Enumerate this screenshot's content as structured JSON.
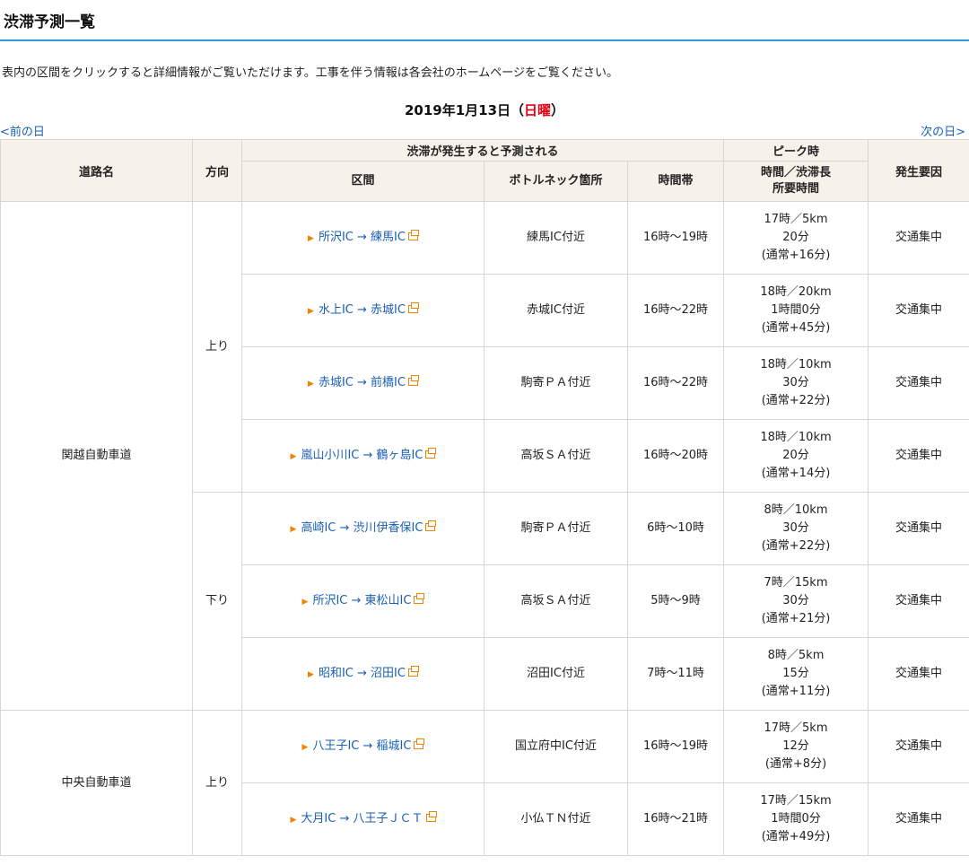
{
  "page": {
    "title": "渋滞予測一覧",
    "intro": "表内の区間をクリックすると詳細情報がご覧いただけます。工事を伴う情報は各会社のホームページをご覧ください。",
    "date": {
      "main": "2019年1月13日（",
      "dow": "日曜",
      "close": "）"
    },
    "prev_day": "<前の日",
    "next_day": "次の日>"
  },
  "table": {
    "headers": {
      "road": "道路名",
      "direction": "方向",
      "predicted_group": "渋滞が発生すると予測される",
      "section": "区間",
      "bottleneck": "ボトルネック箇所",
      "time_band": "時間帯",
      "peak_group": "ピーク時",
      "peak_sub_line1": "時間／渋滞長",
      "peak_sub_line2": "所要時間",
      "cause": "発生要因"
    },
    "roads": [
      {
        "name": "関越自動車道",
        "directions": [
          {
            "label": "上り",
            "rows": [
              {
                "section": "所沢IC → 練馬IC",
                "bottleneck": "練馬IC付近",
                "time": "16時〜19時",
                "peak": "17時／5km",
                "duration": "20分",
                "normal": "(通常+16分)",
                "cause": "交通集中"
              },
              {
                "section": "水上IC → 赤城IC",
                "bottleneck": "赤城IC付近",
                "time": "16時〜22時",
                "peak": "18時／20km",
                "duration": "1時間0分",
                "normal": "(通常+45分)",
                "cause": "交通集中"
              },
              {
                "section": "赤城IC → 前橋IC",
                "bottleneck": "駒寄ＰＡ付近",
                "time": "16時〜22時",
                "peak": "18時／10km",
                "duration": "30分",
                "normal": "(通常+22分)",
                "cause": "交通集中"
              },
              {
                "section": "嵐山小川IC → 鶴ヶ島IC",
                "bottleneck": "高坂ＳＡ付近",
                "time": "16時〜20時",
                "peak": "18時／10km",
                "duration": "20分",
                "normal": "(通常+14分)",
                "cause": "交通集中"
              }
            ]
          },
          {
            "label": "下り",
            "rows": [
              {
                "section": "高崎IC → 渋川伊香保IC",
                "bottleneck": "駒寄ＰＡ付近",
                "time": "6時〜10時",
                "peak": "8時／10km",
                "duration": "30分",
                "normal": "(通常+22分)",
                "cause": "交通集中"
              },
              {
                "section": "所沢IC → 東松山IC",
                "bottleneck": "高坂ＳＡ付近",
                "time": "5時〜9時",
                "peak": "7時／15km",
                "duration": "30分",
                "normal": "(通常+21分)",
                "cause": "交通集中"
              },
              {
                "section": "昭和IC → 沼田IC",
                "bottleneck": "沼田IC付近",
                "time": "7時〜11時",
                "peak": "8時／5km",
                "duration": "15分",
                "normal": "(通常+11分)",
                "cause": "交通集中"
              }
            ]
          }
        ]
      },
      {
        "name": "中央自動車道",
        "directions": [
          {
            "label": "上り",
            "rows": [
              {
                "section": "八王子IC → 稲城IC",
                "bottleneck": "国立府中IC付近",
                "time": "16時〜19時",
                "peak": "17時／5km",
                "duration": "12分",
                "normal": "(通常+8分)",
                "cause": "交通集中"
              },
              {
                "section": "大月IC → 八王子ＪＣＴ",
                "bottleneck": "小仏ＴＮ付近",
                "time": "16時〜21時",
                "peak": "17時／15km",
                "duration": "1時間0分",
                "normal": "(通常+49分)",
                "cause": "交通集中"
              }
            ]
          }
        ]
      }
    ]
  },
  "colors": {
    "title_rule": "#2e9bd6",
    "link": "#1a5fb4",
    "sunday": "#e60012",
    "marker": "#f08300",
    "header_bg": "#f5f2e9",
    "border": "#d6d6d6"
  }
}
